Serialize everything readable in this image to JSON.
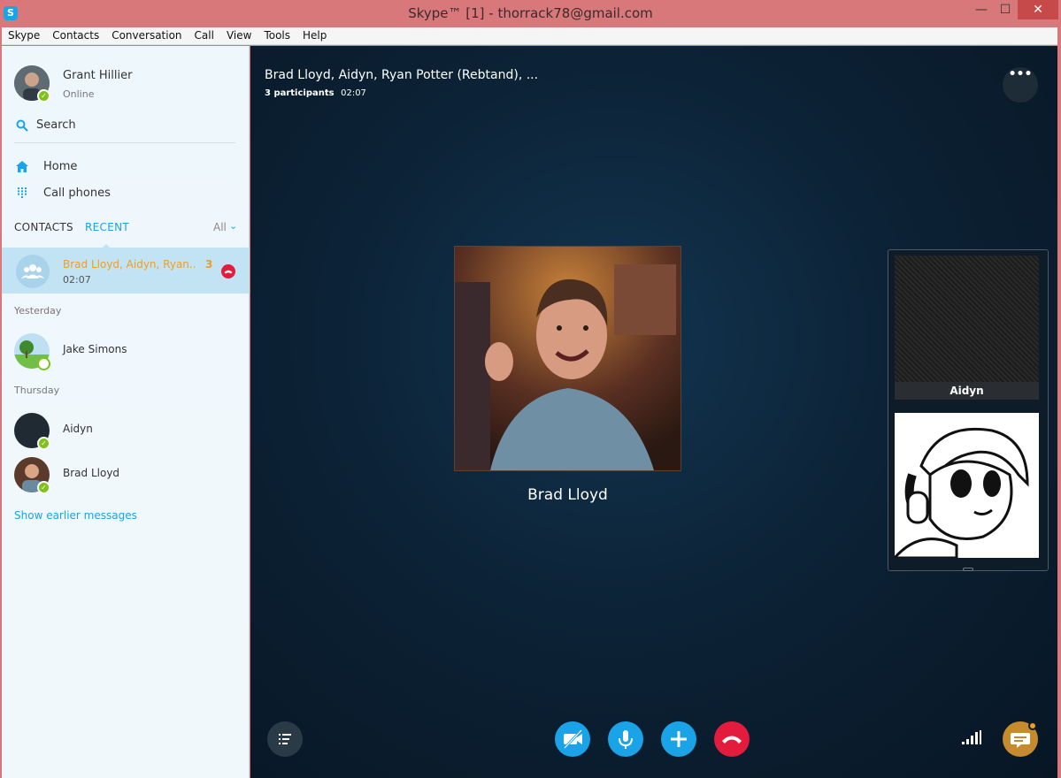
{
  "window": {
    "title": "Skype™ [1] - thorrack78@gmail.com",
    "app_icon_letter": "S",
    "minimize_glyph": "—",
    "maximize_glyph": "☐",
    "close_glyph": "✕"
  },
  "menubar": [
    "Skype",
    "Contacts",
    "Conversation",
    "Call",
    "View",
    "Tools",
    "Help"
  ],
  "profile": {
    "name": "Grant Hillier",
    "status": "Online"
  },
  "search": {
    "label": "Search"
  },
  "nav": [
    {
      "label": "Home",
      "icon": "home-icon"
    },
    {
      "label": "Call phones",
      "icon": "dialpad-icon"
    }
  ],
  "tabs": {
    "contacts": "CONTACTS",
    "recent": "RECENT",
    "filter": "All"
  },
  "recent": {
    "active_conversation": {
      "name": "Brad Lloyd, Aidyn, Ryan...",
      "time": "02:07",
      "count": "3"
    },
    "sections": [
      {
        "label": "Yesterday",
        "contacts": [
          {
            "name": "Jake Simons",
            "status": "away"
          }
        ]
      },
      {
        "label": "Thursday",
        "contacts": [
          {
            "name": "Aidyn",
            "status": "online"
          },
          {
            "name": "Brad Lloyd",
            "status": "online"
          }
        ]
      }
    ],
    "show_earlier": "Show earlier messages"
  },
  "call": {
    "title": "Brad Lloyd, Aidyn, Ryan Potter (Rebtand), ...",
    "participants": "3 participants",
    "duration": "02:07",
    "more_glyph": "•••",
    "speaker_name": "Brad Lloyd",
    "side_tiles": [
      {
        "label": "Aidyn"
      }
    ]
  },
  "colors": {
    "accent": "#1aa3e6",
    "end_call": "#e31c3d",
    "online": "#7ec21b",
    "highlight": "#f39c21"
  }
}
